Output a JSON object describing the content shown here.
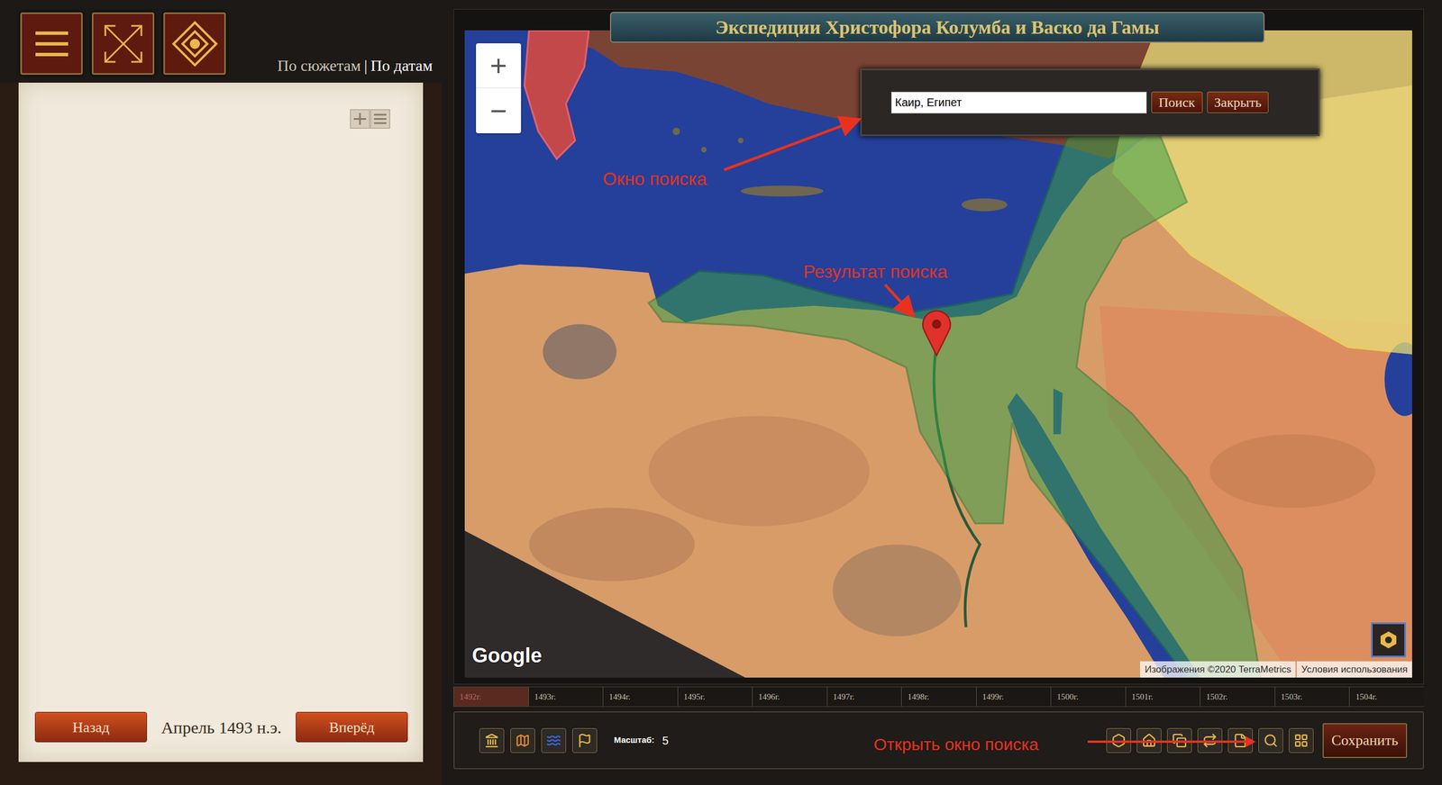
{
  "header": {
    "view_tabs": [
      {
        "label": "По сюжетам",
        "selected": false
      },
      {
        "label": "По датам",
        "selected": true
      }
    ],
    "separator": "|"
  },
  "sidebar": {
    "navigation": {
      "back": "Назад",
      "date": "Апрель 1493 н.э.",
      "forward": "Вперёд"
    }
  },
  "map": {
    "title": "Экспедиции Христофора Колумба и Васко да Гамы",
    "zoom": [
      "+",
      "−"
    ],
    "search": {
      "value": "Каир, Египет",
      "buttons": [
        "Поиск",
        "Закрыть"
      ]
    },
    "annotations": [
      "Окно поиска",
      "Результат поиска"
    ],
    "logo": "Google",
    "attribution": "Изображения ©2020 TerraMetrics",
    "terms": "Условия использования"
  },
  "timeline": [
    {
      "label": "1492г.",
      "selected": true
    },
    {
      "label": "1493г.",
      "selected": false
    },
    {
      "label": "1494г.",
      "selected": false
    },
    {
      "label": "1495г.",
      "selected": false
    },
    {
      "label": "1496г.",
      "selected": false
    },
    {
      "label": "1497г.",
      "selected": false
    },
    {
      "label": "1498г.",
      "selected": false
    },
    {
      "label": "1499г.",
      "selected": false
    },
    {
      "label": "1500г.",
      "selected": false
    },
    {
      "label": "1501г.",
      "selected": false
    },
    {
      "label": "1502г.",
      "selected": false
    },
    {
      "label": "1503г.",
      "selected": false
    },
    {
      "label": "1504г.",
      "selected": false
    }
  ],
  "toolbar": {
    "scale_label": "Масштаб:",
    "scale_value": "5",
    "annotation": "Открыть окно поиска",
    "save": "Сохранить"
  }
}
